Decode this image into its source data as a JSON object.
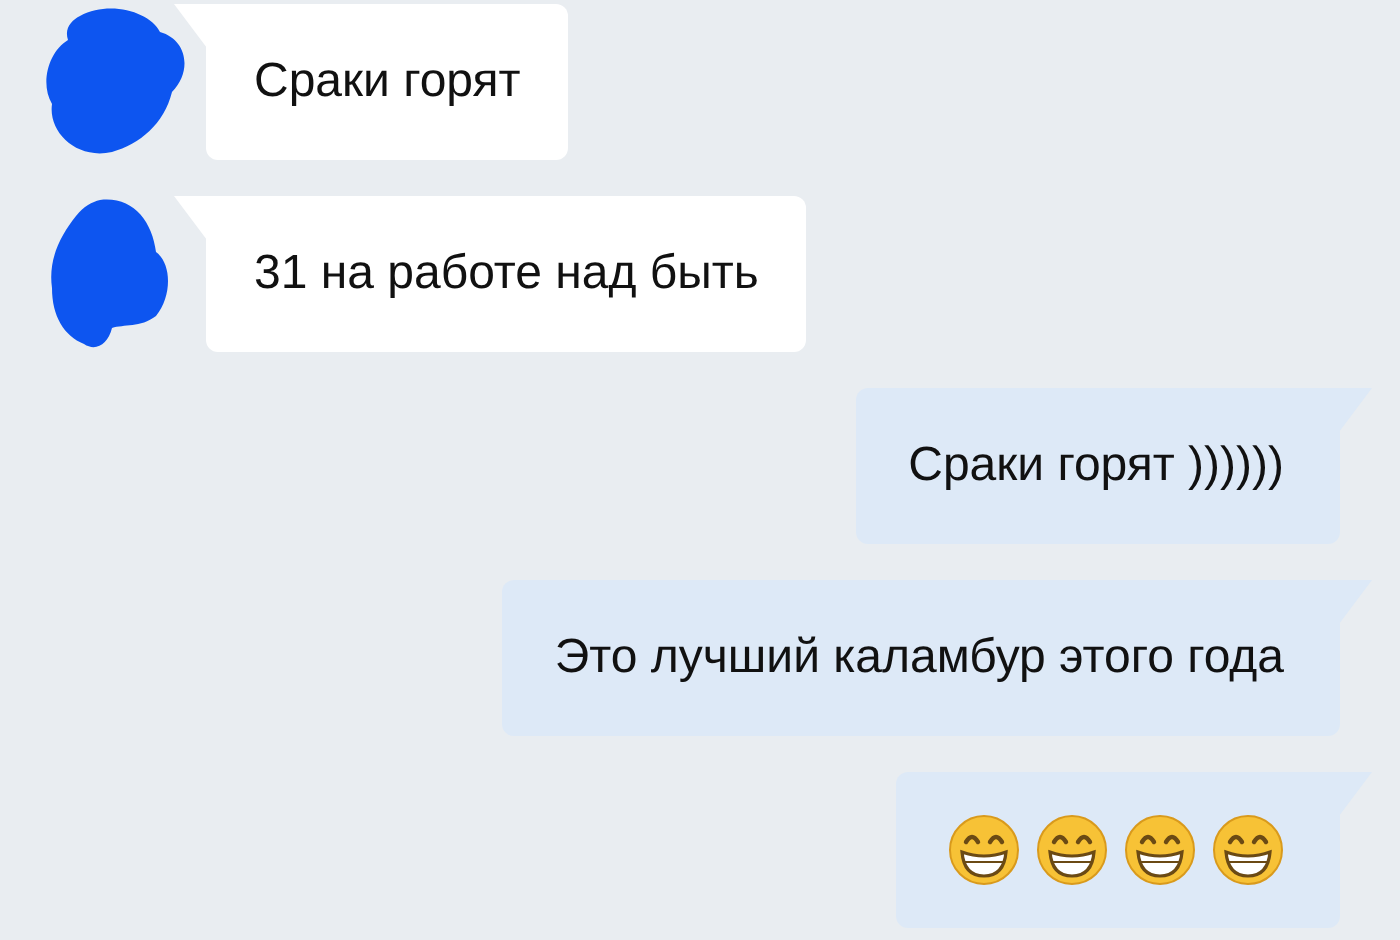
{
  "messages": [
    {
      "outgoing": false,
      "kind": "text",
      "text": "Сраки горят"
    },
    {
      "outgoing": false,
      "kind": "text",
      "text": "31 на работе над быть"
    },
    {
      "outgoing": true,
      "kind": "text",
      "text": "Сраки горят ))))))"
    },
    {
      "outgoing": true,
      "kind": "text",
      "text": "Это лучший каламбур этого года"
    },
    {
      "outgoing": true,
      "kind": "emoji",
      "emojis": [
        {
          "kind": "grin"
        },
        {
          "kind": "grin"
        },
        {
          "kind": "grin"
        },
        {
          "kind": "grin"
        }
      ]
    }
  ]
}
